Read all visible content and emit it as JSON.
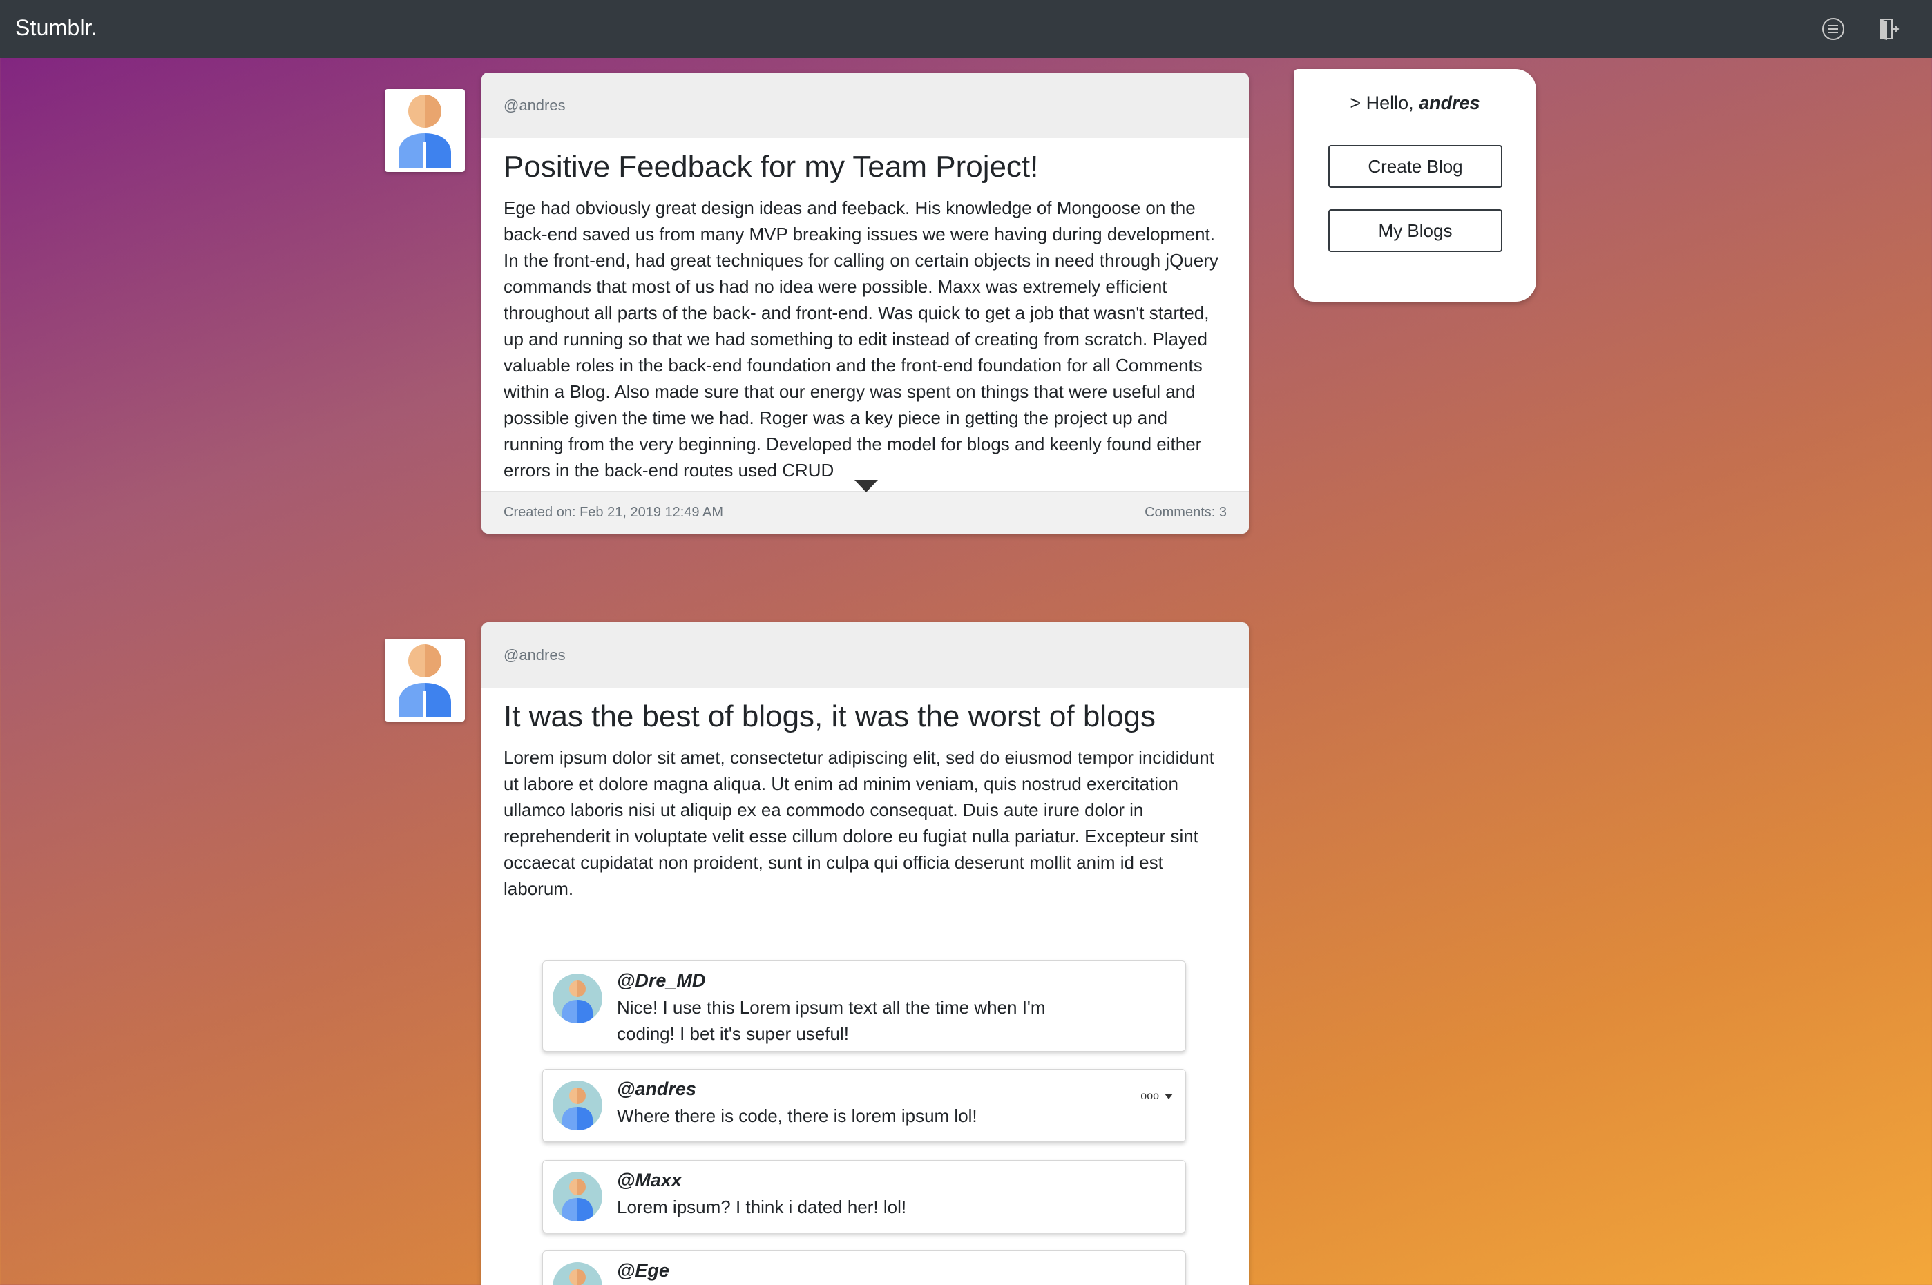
{
  "navbar": {
    "brand": "Stumblr.",
    "icons": [
      "menu-circle-icon",
      "logout-door-icon"
    ]
  },
  "colors": {
    "navbar": "#343a40",
    "gradient_start": "#7e2082",
    "gradient_end": "#f3a73a"
  },
  "side_panel": {
    "greeting_prefix": "> Hello,",
    "username": "andres",
    "create_label": "Create Blog",
    "myblogs_label": "My Blogs"
  },
  "posts": [
    {
      "author": "@andres",
      "title": "Positive Feedback for my Team Project!",
      "body": "Ege had obviously great design ideas and feeback. His knowledge of Mongoose on the back-end saved us from many MVP breaking issues we were having during development. In the front-end, had great techniques for calling on certain objects in need through jQuery commands that most of us had no idea were possible. Maxx was extremely efficient throughout all parts of the back- and front-end. Was quick to get a job that wasn't started, up and running so that we had something to edit instead of creating from scratch. Played valuable roles in the back-end foundation and the front-end foundation for all Comments within a Blog. Also made sure that our energy was spent on things that were useful and possible given the time we had. Roger was a key piece in getting the project up and running from the very beginning. Developed the model for blogs and keenly found either errors in the back-end routes used CRUD",
      "created": "Created on: Feb 21, 2019 12:49 AM",
      "comments_count": "Comments: 3"
    },
    {
      "author": "@andres",
      "title": "It was the best of blogs, it was the worst of blogs",
      "body": "Lorem ipsum dolor sit amet, consectetur adipiscing elit, sed do eiusmod tempor incididunt ut labore et dolore magna aliqua. Ut enim ad minim veniam, quis nostrud exercitation ullamco laboris nisi ut aliquip ex ea commodo consequat. Duis aute irure dolor in reprehenderit in voluptate velit esse cillum dolore eu fugiat nulla pariatur. Excepteur sint occaecat cupidatat non proident, sunt in culpa qui officia deserunt mollit anim id est laborum.",
      "comments": [
        {
          "user": "@Dre_MD",
          "text": "Nice! I use this Lorem ipsum text all the time when I'm coding! I bet it's super useful!"
        },
        {
          "user": "@andres",
          "text": "Where there is code, there is lorem ipsum lol!",
          "menu": "ooo"
        },
        {
          "user": "@Maxx",
          "text": "Lorem ipsum? I think i dated her! lol!"
        },
        {
          "user": "@Ege",
          "text": ""
        }
      ]
    }
  ]
}
